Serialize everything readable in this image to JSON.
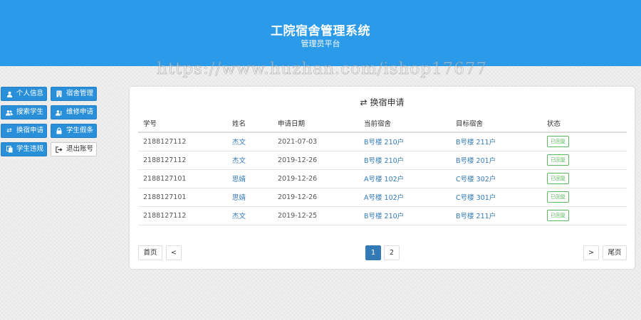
{
  "header": {
    "title": "工院宿舍管理系统",
    "subtitle": "管理员平台"
  },
  "watermark": "https://www.huzhan.com/ishop17677",
  "sidebar": {
    "items": [
      {
        "label": "个人信息",
        "icon": "user-icon"
      },
      {
        "label": "宿舍管理",
        "icon": "building-icon"
      },
      {
        "label": "搜索学生",
        "icon": "users-icon"
      },
      {
        "label": "维修申请",
        "icon": "repair-icon"
      },
      {
        "label": "换宿申请",
        "icon": "exchange-icon"
      },
      {
        "label": "学生假条",
        "icon": "lock-icon"
      },
      {
        "label": "学生违规",
        "icon": "copy-icon"
      },
      {
        "label": "退出账号",
        "icon": "logout-icon"
      }
    ]
  },
  "panel": {
    "title": "换宿申请",
    "icon": "exchange-icon",
    "columns": [
      "学号",
      "姓名",
      "申请日期",
      "当前宿舍",
      "目标宿舍",
      "状态"
    ],
    "rows": [
      {
        "student_id": "2188127112",
        "name": "杰文",
        "date": "2021-07-03",
        "current": "B号楼 210户",
        "target": "B号楼 211户",
        "status": "已回复"
      },
      {
        "student_id": "2188127112",
        "name": "杰文",
        "date": "2019-12-26",
        "current": "B号楼 210户",
        "target": "B号楼 201户",
        "status": "已回复"
      },
      {
        "student_id": "2188127101",
        "name": "思婧",
        "date": "2019-12-26",
        "current": "A号楼 102户",
        "target": "C号楼 302户",
        "status": "已回复"
      },
      {
        "student_id": "2188127101",
        "name": "思婧",
        "date": "2019-12-26",
        "current": "A号楼 102户",
        "target": "C号楼 301户",
        "status": "已回复"
      },
      {
        "student_id": "2188127112",
        "name": "杰文",
        "date": "2019-12-25",
        "current": "B号楼 210户",
        "target": "B号楼 211户",
        "status": "已回复"
      }
    ]
  },
  "pagination": {
    "first": "首页",
    "prev": "<",
    "pages": [
      "1",
      "2"
    ],
    "current_page": "1",
    "next": ">",
    "last": "尾页"
  },
  "colors": {
    "header": "#2b9ae8",
    "sidebar_button": "#2a8fd9",
    "link": "#337ab7",
    "status": "#5cb85c"
  }
}
